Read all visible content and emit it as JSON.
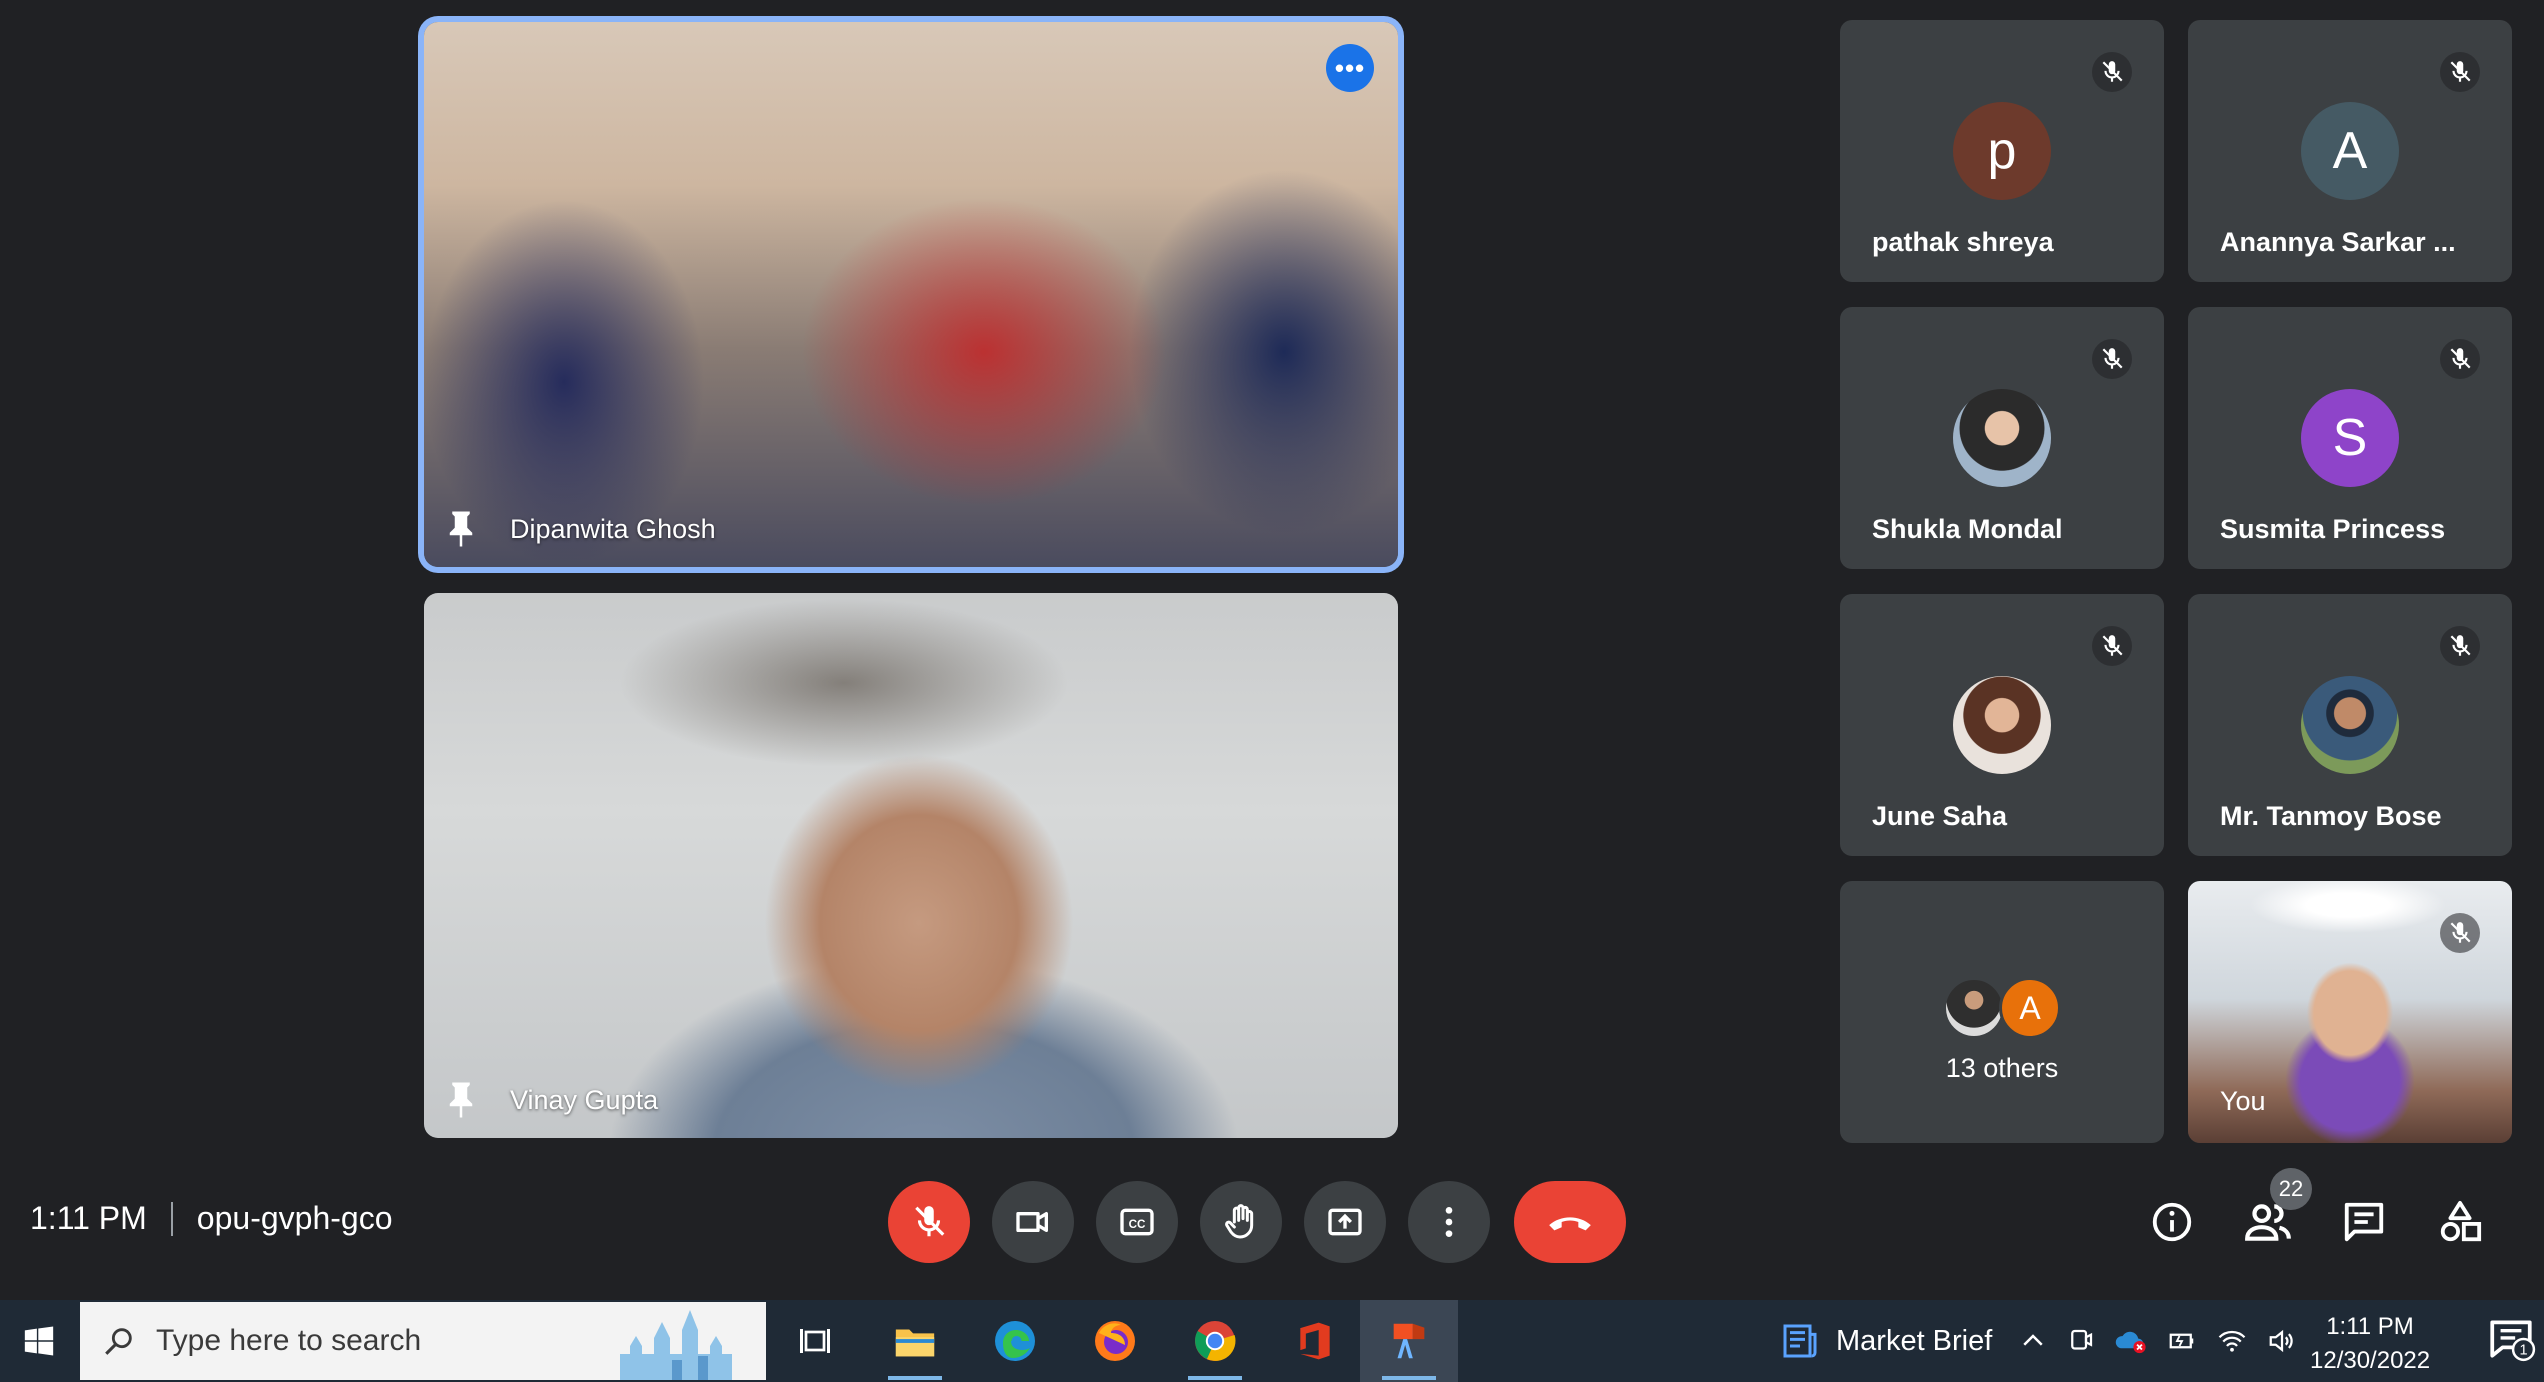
{
  "meeting": {
    "time": "1:11 PM",
    "code": "opu-gvph-gco",
    "participant_count": "22"
  },
  "main_tiles": [
    {
      "name": "Dipanwita Ghosh"
    },
    {
      "name": "Vinay Gupta"
    }
  ],
  "side_tiles": [
    {
      "name": "pathak shreya",
      "initial": "p",
      "avatar_color": "#6d3a2c"
    },
    {
      "name": "Anannya Sarkar ...",
      "initial": "A",
      "avatar_color": "#455a64"
    },
    {
      "name": "Shukla Mondal",
      "initial": "",
      "avatar_color": "#2b2b2b"
    },
    {
      "name": "Susmita Princess",
      "initial": "S",
      "avatar_color": "#8e44c9"
    },
    {
      "name": "June Saha",
      "initial": "",
      "avatar_color": "#b23a3a"
    },
    {
      "name": "Mr. Tanmoy Bose",
      "initial": "",
      "avatar_color": "#3a5a7a"
    }
  ],
  "others": {
    "label": "13 others",
    "initial": "A",
    "avatar_color": "#e8710a"
  },
  "self_tile": {
    "name": "You"
  },
  "controls": {
    "mic": "mic-off",
    "camera": "camera",
    "captions": "captions",
    "hand": "raise-hand",
    "present": "present-screen",
    "more": "more-options",
    "leave": "leave-call"
  },
  "colors": {
    "background": "#202124",
    "tile": "#3c4043",
    "danger": "#ea4335",
    "accent": "#8ab4f8"
  },
  "taskbar": {
    "search_placeholder": "Type here to search",
    "news_label": "Market Brief",
    "time": "1:11 PM",
    "date": "12/30/2022",
    "notification_count": "1"
  }
}
